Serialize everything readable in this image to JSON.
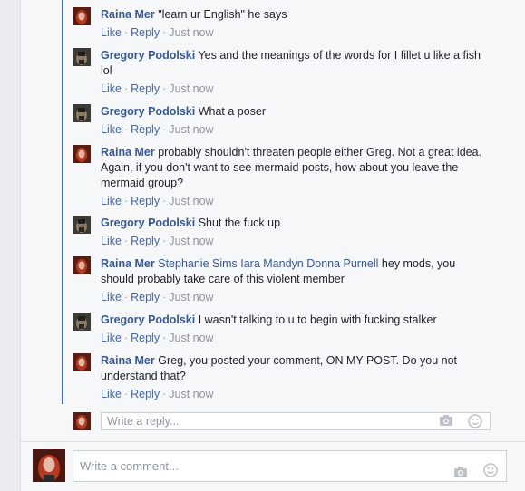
{
  "comments": [
    {
      "author": "Raina Mer",
      "text": "\"learn ur English\" he says",
      "avatar": "raina"
    },
    {
      "author": "Gregory Podolski",
      "text": "Yes and the meanings of the words for I fillet u like a fish lol",
      "avatar": "gregory"
    },
    {
      "author": "Gregory Podolski",
      "text": "What a poser",
      "avatar": "gregory"
    },
    {
      "author": "Raina Mer",
      "text": "probably shouldn't threaten people either Greg. Not a great idea. Again, if you don't want to see mermaid posts, how about you leave the mermaid group?",
      "avatar": "raina"
    },
    {
      "author": "Gregory Podolski",
      "text": "Shut the fuck up",
      "avatar": "gregory"
    },
    {
      "author": "Raina Mer",
      "mentions": "Stephanie Sims Iara Mandyn Donna Purnell",
      "text": "hey mods, you should probably take care of this violent member",
      "avatar": "raina"
    },
    {
      "author": "Gregory Podolski",
      "text": "I wasn't talking to u to begin with fucking stalker",
      "avatar": "gregory"
    },
    {
      "author": "Raina Mer",
      "text": "Greg, you posted your comment, ON MY POST. Do you not understand that?",
      "avatar": "raina"
    }
  ],
  "actions": {
    "like": "Like",
    "reply": "Reply",
    "time": "Just now",
    "dot": "·"
  },
  "reply_box": {
    "placeholder": "Write a reply..."
  },
  "comment_box": {
    "placeholder": "Write a comment..."
  },
  "icons": {
    "camera": "camera-icon",
    "emoji": "emoji-icon"
  },
  "colors": {
    "link": "#365899",
    "action": "#4267b2",
    "meta": "#90949c",
    "thread": "#4267b2"
  }
}
